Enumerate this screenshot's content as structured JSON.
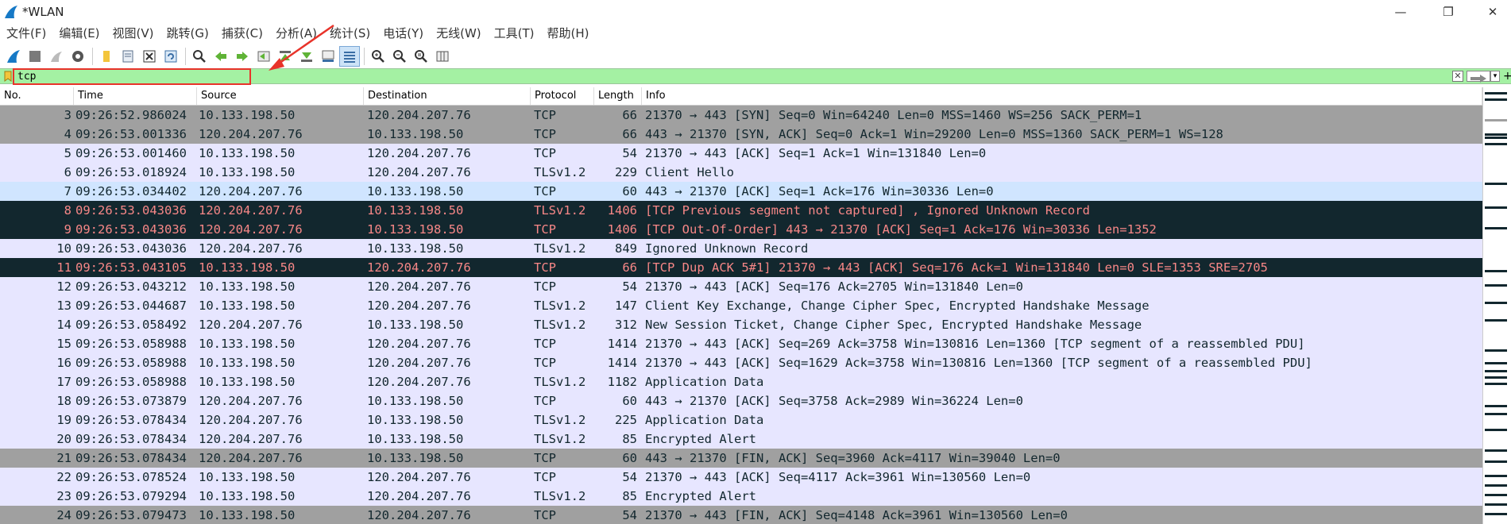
{
  "window": {
    "title": "*WLAN"
  },
  "menu": [
    "文件(F)",
    "编辑(E)",
    "视图(V)",
    "跳转(G)",
    "捕获(C)",
    "分析(A)",
    "统计(S)",
    "电话(Y)",
    "无线(W)",
    "工具(T)",
    "帮助(H)"
  ],
  "filter": {
    "value": "tcp"
  },
  "columns": {
    "no": "No.",
    "time": "Time",
    "source": "Source",
    "destination": "Destination",
    "protocol": "Protocol",
    "length": "Length",
    "info": "Info"
  },
  "packets": [
    {
      "no": "3",
      "time": "09:26:52.986024",
      "src": "10.133.198.50",
      "dst": "120.204.207.76",
      "proto": "TCP",
      "len": "66",
      "info": "21370 → 443 [SYN] Seq=0 Win=64240 Len=0 MSS=1460 WS=256 SACK_PERM=1",
      "style": "gray"
    },
    {
      "no": "4",
      "time": "09:26:53.001336",
      "src": "120.204.207.76",
      "dst": "10.133.198.50",
      "proto": "TCP",
      "len": "66",
      "info": "443 → 21370 [SYN, ACK] Seq=0 Ack=1 Win=29200 Len=0 MSS=1360 SACK_PERM=1 WS=128",
      "style": "gray"
    },
    {
      "no": "5",
      "time": "09:26:53.001460",
      "src": "10.133.198.50",
      "dst": "120.204.207.76",
      "proto": "TCP",
      "len": "54",
      "info": "21370 → 443 [ACK] Seq=1 Ack=1 Win=131840 Len=0",
      "style": "lav"
    },
    {
      "no": "6",
      "time": "09:26:53.018924",
      "src": "10.133.198.50",
      "dst": "120.204.207.76",
      "proto": "TLSv1.2",
      "len": "229",
      "info": "Client Hello",
      "style": "lav"
    },
    {
      "no": "7",
      "time": "09:26:53.034402",
      "src": "120.204.207.76",
      "dst": "10.133.198.50",
      "proto": "TCP",
      "len": "60",
      "info": "443 → 21370 [ACK] Seq=1 Ack=176 Win=30336 Len=0",
      "style": "selected"
    },
    {
      "no": "8",
      "time": "09:26:53.043036",
      "src": "120.204.207.76",
      "dst": "10.133.198.50",
      "proto": "TLSv1.2",
      "len": "1406",
      "info": "[TCP Previous segment not captured] , Ignored Unknown Record",
      "style": "bad"
    },
    {
      "no": "9",
      "time": "09:26:53.043036",
      "src": "120.204.207.76",
      "dst": "10.133.198.50",
      "proto": "TCP",
      "len": "1406",
      "info": "[TCP Out-Of-Order] 443 → 21370 [ACK] Seq=1 Ack=176 Win=30336 Len=1352",
      "style": "bad"
    },
    {
      "no": "10",
      "time": "09:26:53.043036",
      "src": "120.204.207.76",
      "dst": "10.133.198.50",
      "proto": "TLSv1.2",
      "len": "849",
      "info": "Ignored Unknown Record",
      "style": "lav"
    },
    {
      "no": "11",
      "time": "09:26:53.043105",
      "src": "10.133.198.50",
      "dst": "120.204.207.76",
      "proto": "TCP",
      "len": "66",
      "info": "[TCP Dup ACK 5#1] 21370 → 443 [ACK] Seq=176 Ack=1 Win=131840 Len=0 SLE=1353 SRE=2705",
      "style": "bad"
    },
    {
      "no": "12",
      "time": "09:26:53.043212",
      "src": "10.133.198.50",
      "dst": "120.204.207.76",
      "proto": "TCP",
      "len": "54",
      "info": "21370 → 443 [ACK] Seq=176 Ack=2705 Win=131840 Len=0",
      "style": "lav"
    },
    {
      "no": "13",
      "time": "09:26:53.044687",
      "src": "10.133.198.50",
      "dst": "120.204.207.76",
      "proto": "TLSv1.2",
      "len": "147",
      "info": "Client Key Exchange, Change Cipher Spec, Encrypted Handshake Message",
      "style": "lav"
    },
    {
      "no": "14",
      "time": "09:26:53.058492",
      "src": "120.204.207.76",
      "dst": "10.133.198.50",
      "proto": "TLSv1.2",
      "len": "312",
      "info": "New Session Ticket, Change Cipher Spec, Encrypted Handshake Message",
      "style": "lav"
    },
    {
      "no": "15",
      "time": "09:26:53.058988",
      "src": "10.133.198.50",
      "dst": "120.204.207.76",
      "proto": "TCP",
      "len": "1414",
      "info": "21370 → 443 [ACK] Seq=269 Ack=3758 Win=130816 Len=1360 [TCP segment of a reassembled PDU]",
      "style": "lav"
    },
    {
      "no": "16",
      "time": "09:26:53.058988",
      "src": "10.133.198.50",
      "dst": "120.204.207.76",
      "proto": "TCP",
      "len": "1414",
      "info": "21370 → 443 [ACK] Seq=1629 Ack=3758 Win=130816 Len=1360 [TCP segment of a reassembled PDU]",
      "style": "lav"
    },
    {
      "no": "17",
      "time": "09:26:53.058988",
      "src": "10.133.198.50",
      "dst": "120.204.207.76",
      "proto": "TLSv1.2",
      "len": "1182",
      "info": "Application Data",
      "style": "lav"
    },
    {
      "no": "18",
      "time": "09:26:53.073879",
      "src": "120.204.207.76",
      "dst": "10.133.198.50",
      "proto": "TCP",
      "len": "60",
      "info": "443 → 21370 [ACK] Seq=3758 Ack=2989 Win=36224 Len=0",
      "style": "lav"
    },
    {
      "no": "19",
      "time": "09:26:53.078434",
      "src": "120.204.207.76",
      "dst": "10.133.198.50",
      "proto": "TLSv1.2",
      "len": "225",
      "info": "Application Data",
      "style": "lav"
    },
    {
      "no": "20",
      "time": "09:26:53.078434",
      "src": "120.204.207.76",
      "dst": "10.133.198.50",
      "proto": "TLSv1.2",
      "len": "85",
      "info": "Encrypted Alert",
      "style": "lav"
    },
    {
      "no": "21",
      "time": "09:26:53.078434",
      "src": "120.204.207.76",
      "dst": "10.133.198.50",
      "proto": "TCP",
      "len": "60",
      "info": "443 → 21370 [FIN, ACK] Seq=3960 Ack=4117 Win=39040 Len=0",
      "style": "gray"
    },
    {
      "no": "22",
      "time": "09:26:53.078524",
      "src": "10.133.198.50",
      "dst": "120.204.207.76",
      "proto": "TCP",
      "len": "54",
      "info": "21370 → 443 [ACK] Seq=4117 Ack=3961 Win=130560 Len=0",
      "style": "lav"
    },
    {
      "no": "23",
      "time": "09:26:53.079294",
      "src": "10.133.198.50",
      "dst": "120.204.207.76",
      "proto": "TLSv1.2",
      "len": "85",
      "info": "Encrypted Alert",
      "style": "lav"
    },
    {
      "no": "24",
      "time": "09:26:53.079473",
      "src": "10.133.198.50",
      "dst": "120.204.207.76",
      "proto": "TCP",
      "len": "54",
      "info": "21370 → 443 [FIN, ACK] Seq=4148 Ack=3961 Win=130560 Len=0",
      "style": "gray"
    }
  ],
  "colors": {
    "filter_bg": "#a4f1a3",
    "annotation": "#e8332a",
    "bad_bg": "#12272e",
    "bad_fg": "#f78787",
    "gray_row": "#a0a0a0",
    "lav_row": "#e7e6ff",
    "selected_row": "#d0e5ff"
  }
}
